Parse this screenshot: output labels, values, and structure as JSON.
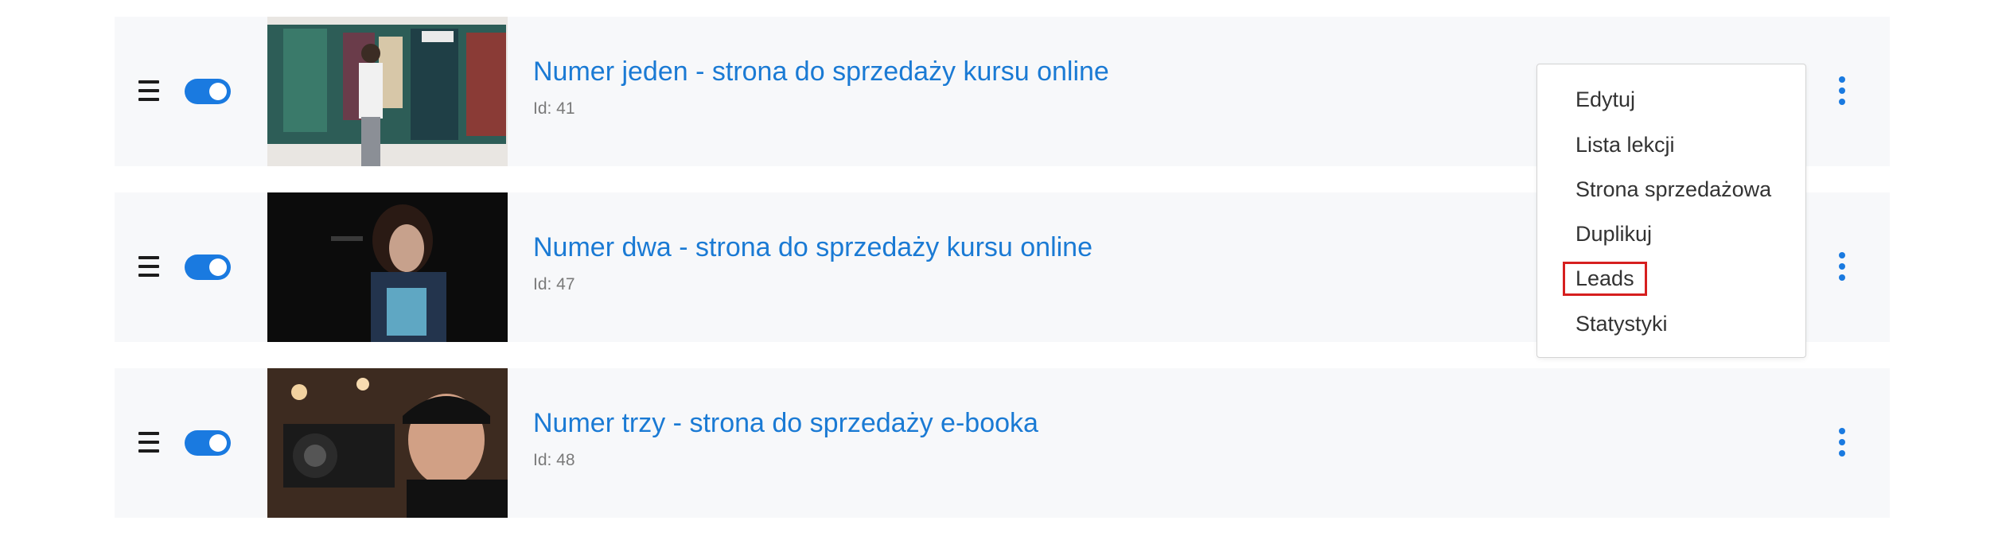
{
  "courses": [
    {
      "title": "Numer jeden - strona do sprzedaży kursu online",
      "id_text": "Id: 41",
      "enabled": true,
      "image": "artist-painting-mural-photo"
    },
    {
      "title": "Numer dwa - strona do sprzedaży kursu online",
      "id_text": "Id: 47",
      "enabled": true,
      "image": "singer-performing-photo"
    },
    {
      "title": "Numer trzy - strona do sprzedaży e-booka",
      "id_text": "Id: 48",
      "enabled": true,
      "image": "cameraman-with-camera-photo"
    }
  ],
  "menu": {
    "items": [
      {
        "label": "Edytuj"
      },
      {
        "label": "Lista lekcji"
      },
      {
        "label": "Strona sprzedażowa"
      },
      {
        "label": "Duplikuj"
      },
      {
        "label": "Leads",
        "highlighted": true
      },
      {
        "label": "Statystyki"
      }
    ]
  },
  "colors": {
    "accent": "#1a7ae0",
    "title": "#1a7ad4",
    "row_background": "#f7f8fa",
    "highlight_border": "#d61f1f"
  },
  "icons": {
    "drag": "drag-handle-icon",
    "toggle": "toggle-switch",
    "more": "more-vertical-icon"
  }
}
